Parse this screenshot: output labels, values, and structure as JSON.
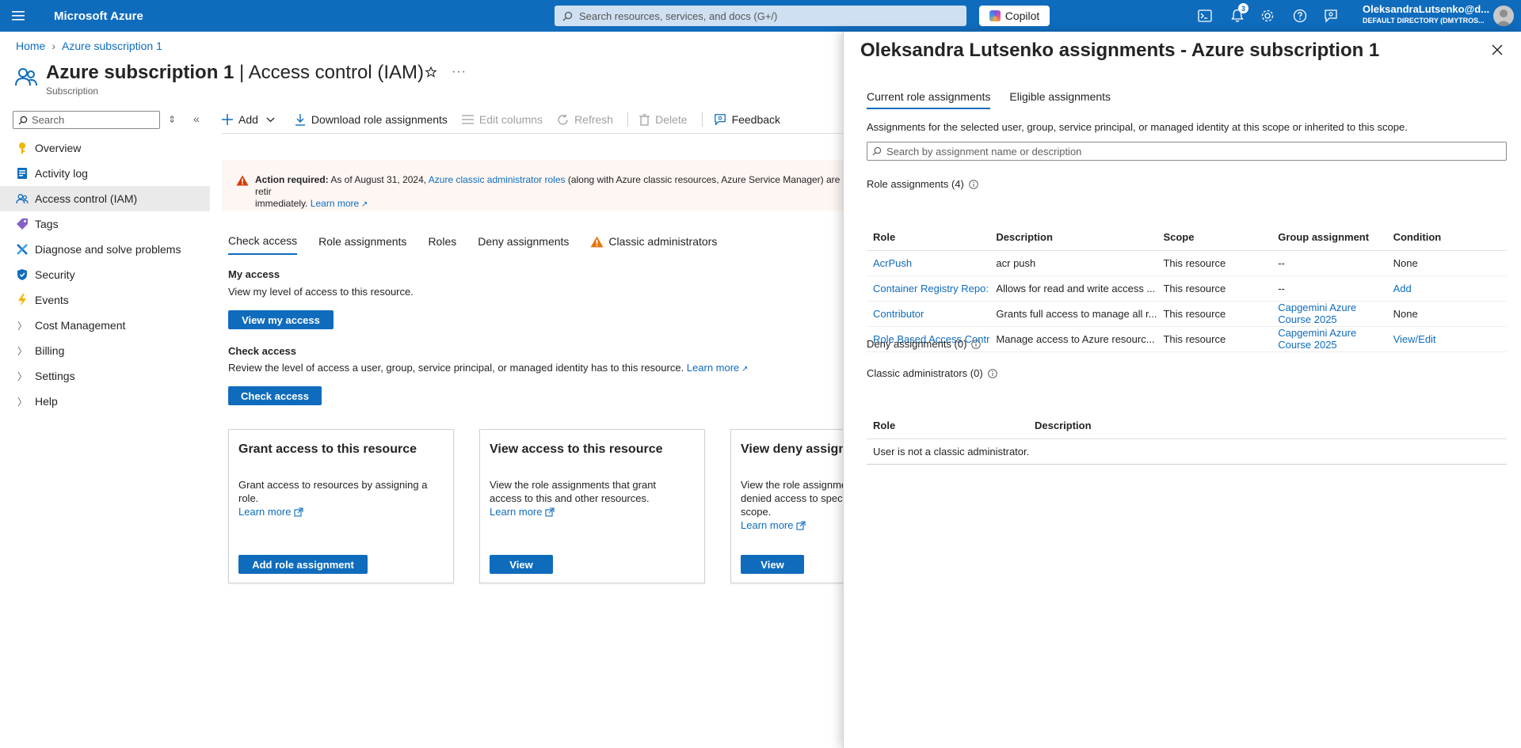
{
  "topbar": {
    "brand": "Microsoft Azure",
    "search_placeholder": "Search resources, services, and docs (G+/)",
    "copilot_label": "Copilot",
    "notifications_count": "3",
    "account_name": "OleksandraLutsenko@d...",
    "account_directory": "DEFAULT DIRECTORY (DMYTROS..."
  },
  "breadcrumb": {
    "home": "Home",
    "current": "Azure subscription 1"
  },
  "header": {
    "title_bold": "Azure subscription 1",
    "title_rest": " | Access control (IAM)",
    "subtitle": "Subscription"
  },
  "sidebar": {
    "search_placeholder": "Search",
    "items": [
      {
        "label": "Overview",
        "icon": "key-icon"
      },
      {
        "label": "Activity log",
        "icon": "activity-log-icon"
      },
      {
        "label": "Access control (IAM)",
        "icon": "people-icon"
      },
      {
        "label": "Tags",
        "icon": "tag-icon"
      },
      {
        "label": "Diagnose and solve problems",
        "icon": "wrench-icon"
      },
      {
        "label": "Security",
        "icon": "shield-icon"
      },
      {
        "label": "Events",
        "icon": "lightning-icon"
      },
      {
        "label": "Cost Management",
        "icon": "chevron-right-icon"
      },
      {
        "label": "Billing",
        "icon": "chevron-right-icon"
      },
      {
        "label": "Settings",
        "icon": "chevron-right-icon"
      },
      {
        "label": "Help",
        "icon": "chevron-right-icon"
      }
    ]
  },
  "commandbar": {
    "add": "Add",
    "download": "Download role assignments",
    "edit_columns": "Edit columns",
    "refresh": "Refresh",
    "delete": "Delete",
    "feedback": "Feedback"
  },
  "banner": {
    "strong": "Action required:",
    "text1": " As of August 31, 2024, ",
    "link1": "Azure classic administrator roles",
    "text2": " (along with Azure classic resources, Azure Service Manager) are retir",
    "text3": "immediately. ",
    "link2": "Learn more"
  },
  "main_tabs": [
    "Check access",
    "Role assignments",
    "Roles",
    "Deny assignments",
    "Classic administrators"
  ],
  "my_access": {
    "title": "My access",
    "text": "View my level of access to this resource.",
    "button": "View my access"
  },
  "check_access": {
    "title": "Check access",
    "text": "Review the level of access a user, group, service principal, or managed identity has to this resource. ",
    "link": "Learn more",
    "button": "Check access"
  },
  "cards": [
    {
      "title": "Grant access to this resource",
      "desc": "Grant access to resources by assigning a role.",
      "link": "Learn more",
      "button": "Add role assignment"
    },
    {
      "title": "View access to this resource",
      "desc": "View the role assignments that grant access to this and other resources.",
      "link": "Learn more",
      "button": "View"
    },
    {
      "title": "View deny assignments",
      "desc": "View the role assignments that have been denied access to specific actions at this scope.",
      "link": "Learn more",
      "button": "View"
    }
  ],
  "panel": {
    "title": "Oleksandra Lutsenko assignments - Azure subscription 1",
    "tabs": [
      "Current role assignments",
      "Eligible assignments"
    ],
    "description": "Assignments for the selected user, group, service principal, or managed identity at this scope or inherited to this scope.",
    "search_placeholder": "Search by assignment name or description",
    "role_assignments_label": "Role assignments (4)",
    "columns": [
      "Role",
      "Description",
      "Scope",
      "Group assignment",
      "Condition"
    ],
    "rows": [
      {
        "role": "AcrPush",
        "description": "acr push",
        "scope": "This resource",
        "group": "--",
        "condition": "None"
      },
      {
        "role": "Container Registry Repo:",
        "description": "Allows for read and write access ...",
        "scope": "This resource",
        "group": "--",
        "condition": "Add"
      },
      {
        "role": "Contributor",
        "description": "Grants full access to manage all r...",
        "scope": "This resource",
        "group": "Capgemini Azure Course 2025",
        "condition": "None"
      },
      {
        "role": "Role Based Access Contr",
        "description": "Manage access to Azure resourc...",
        "scope": "This resource",
        "group": "Capgemini Azure Course 2025",
        "condition": "View/Edit"
      }
    ],
    "deny_label": "Deny assignments (0)",
    "classic_label": "Classic administrators (0)",
    "classic_columns": [
      "Role",
      "Description"
    ],
    "classic_empty": "User is not a classic administrator."
  }
}
